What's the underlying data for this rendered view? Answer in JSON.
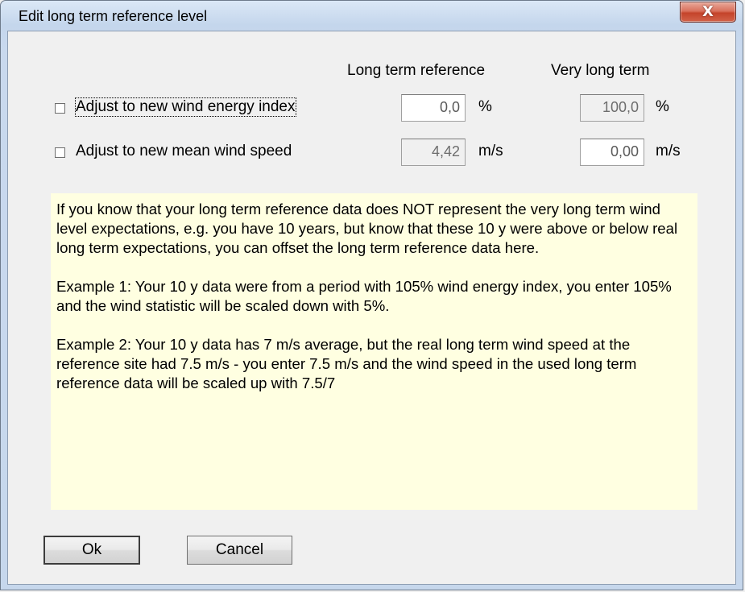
{
  "window": {
    "title": "Edit long term reference level",
    "close_glyph": "X"
  },
  "columns": {
    "long_term": "Long term reference",
    "very_long_term": "Very long term"
  },
  "rows": [
    {
      "label": "Adjust to new wind energy index",
      "checked": false,
      "long_term_value": "0,0",
      "long_term_enabled": true,
      "long_term_unit": "%",
      "very_long_value": "100,0",
      "very_long_enabled": false,
      "very_long_unit": "%"
    },
    {
      "label": "Adjust to new mean wind speed",
      "checked": false,
      "long_term_value": "4,42",
      "long_term_enabled": false,
      "long_term_unit": "m/s",
      "very_long_value": "0,00",
      "very_long_enabled": true,
      "very_long_unit": "m/s"
    }
  ],
  "info": {
    "paragraph1": "If you know that your long term reference data does NOT represent the very long term wind level expectations, e.g. you have 10 years, but know that these 10 y were above or below real long term expectations, you can offset the long term reference data here.",
    "paragraph2": "Example 1: Your 10 y data were from a period with 105% wind energy index, you enter 105% and the wind statistic will be scaled down with 5%.",
    "paragraph3": "Example 2: Your 10 y data has 7 m/s average, but the real long term wind speed at the reference site had 7.5 m/s - you enter 7.5 m/s and the wind speed in the used long term reference data will be scaled up with 7.5/7"
  },
  "buttons": {
    "ok": "Ok",
    "cancel": "Cancel"
  },
  "colors": {
    "info_background": "#ffffe1",
    "close_button": "#c4432a",
    "titlebar": "#c4d6ec"
  }
}
